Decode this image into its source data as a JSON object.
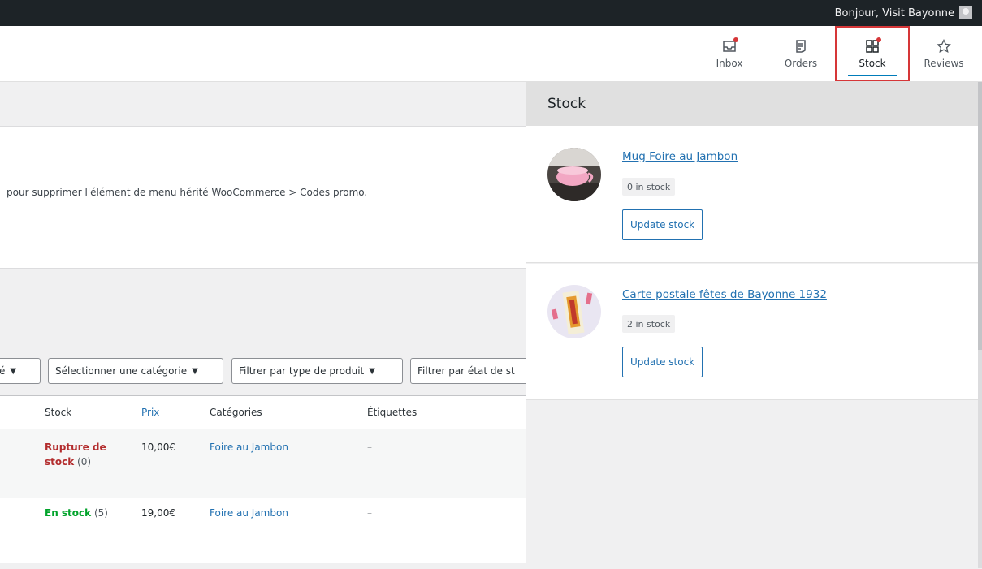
{
  "adminbar": {
    "greeting": "Bonjour, Visit Bayonne"
  },
  "activity_tabs": [
    {
      "label": "Inbox",
      "icon": "inbox-icon",
      "has_dot": true
    },
    {
      "label": "Orders",
      "icon": "orders-icon",
      "has_dot": false
    },
    {
      "label": "Stock",
      "icon": "stock-icon",
      "has_dot": true,
      "active": true
    },
    {
      "label": "Reviews",
      "icon": "star-icon",
      "has_dot": false
    }
  ],
  "notice": {
    "text": "pour supprimer l'élément de menu hérité WooCommerce > Codes promo."
  },
  "filters": {
    "partial": "é",
    "category": "Sélectionner une catégorie",
    "product_type": "Filtrer par type de produit",
    "stock_state": "Filtrer par état de st"
  },
  "table": {
    "headers": {
      "stock": "Stock",
      "price": "Prix",
      "categories": "Catégories",
      "tags": "Étiquettes"
    },
    "rows": [
      {
        "stock_status": "Rupture de stock",
        "stock_count": "(0)",
        "price": "10,00€",
        "category": "Foire au Jambon",
        "tags": "–"
      },
      {
        "stock_status": "En stock",
        "stock_count": "(5)",
        "price": "19,00€",
        "category": "Foire au Jambon",
        "tags": "–"
      }
    ]
  },
  "stock_panel": {
    "title": "Stock",
    "items": [
      {
        "name": "Mug Foire au Jambon",
        "stock": "0 in stock",
        "button": "Update stock"
      },
      {
        "name": "Carte postale fêtes de Bayonne 1932",
        "stock": "2 in stock",
        "button": "Update stock"
      }
    ]
  },
  "colors": {
    "accent": "#2271b1",
    "out_of_stock": "#b32d2e",
    "in_stock": "#00a32a",
    "highlight": "#d63638"
  }
}
